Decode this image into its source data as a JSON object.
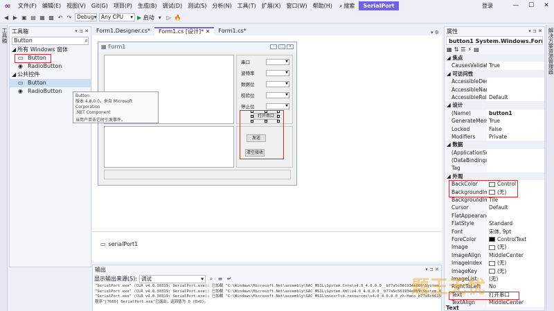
{
  "menu": {
    "items": [
      "文件(F)",
      "编辑(E)",
      "视图(V)",
      "Git(G)",
      "项目(P)",
      "生成(B)",
      "调试(D)",
      "测试(S)",
      "分析(N)",
      "工具(T)",
      "扩展(X)",
      "窗口(W)",
      "帮助(H)"
    ],
    "search_label": "搜索",
    "project_name": "SerialPort",
    "login": "登录"
  },
  "toolbar": {
    "config": "Debug",
    "platform": "Any CPU",
    "start_label": "启动"
  },
  "side": {
    "left_label": "工具箱",
    "right_label": "解决方案资源管理器"
  },
  "toolbox": {
    "title": "工具箱",
    "search_value": "Button",
    "groups": [
      {
        "label": "所有 Windows 窗体",
        "items": [
          "Button",
          "RadioButton"
        ]
      },
      {
        "label": "公共控件",
        "items": [
          "Button",
          "RadioButton"
        ]
      }
    ],
    "tooltip": {
      "name": "Button",
      "version": "版本 4.8.0.0，来自 Microsoft Corporation",
      "component": ".NET Component",
      "desc": "当用户单击它时引发事件。"
    }
  },
  "tabs": [
    "Form1.Designer.cs*",
    "Form1.cs [设计]*",
    "Form1.cs*"
  ],
  "form": {
    "title": "Form1",
    "fields": [
      {
        "label": "串口"
      },
      {
        "label": "波特率"
      },
      {
        "label": "数据位"
      },
      {
        "label": "校验位"
      },
      {
        "label": "停止位"
      }
    ],
    "open_button": "打开串口",
    "send_button": "发送",
    "clear_button": "清空接收"
  },
  "tray": {
    "component": "serialPort1"
  },
  "output": {
    "title": "输出",
    "source_label": "显示输出来源(S):",
    "source_value": "调试",
    "lines": [
      "\"SerialPort.exe\" (CLR v4.0.30319: SerialPort.exe): 已加载 \"C:\\Windows\\Microsoft.Net\\assembly\\GAC_MSIL\\System.Core\\v4.0_4.0.0.0__b77a5c561934e089\\System.Core.dll\"",
      "\"SerialPort.exe\" (CLR v4.0.30319: SerialPort.exe): 已加载 \"C:\\Windows\\Microsoft.Net\\assembly\\GAC_MSIL\\System.Xml\\v4.0_4.0.0.0__b77a5c561934e089\\System.Xml.dll\"",
      "\"SerialPort.exe\" (CLR v4.0.30319: SerialPort.exe): 已加载 \"C:\\Windows\\Microsoft.Net\\assembly\\GAC_MSIL\\mscorlib.resources\\v4.0_4.0.0.0_zh-Hans_b77a5c561934e089\\mscorlib.resources.dll\"",
      "程序\"[7660] SerialPort.exe\"已退出，返回值为 0 (0x0)。"
    ]
  },
  "properties": {
    "title": "属性",
    "object": "button1 System.Windows.Forms.Bu",
    "rows": [
      {
        "cat": "焦点"
      },
      {
        "name": "CausesValidatio",
        "value": "True"
      },
      {
        "cat": "可访问性"
      },
      {
        "name": "AccessibleDescr",
        "value": ""
      },
      {
        "name": "AccessibleName",
        "value": ""
      },
      {
        "name": "AccessibleRole",
        "value": "Default"
      },
      {
        "cat": "设计"
      },
      {
        "name": "(Name)",
        "value": "button1",
        "bold": true
      },
      {
        "name": "GenerateMembe",
        "value": "True"
      },
      {
        "name": "Locked",
        "value": "False"
      },
      {
        "name": "Modifiers",
        "value": "Private"
      },
      {
        "cat": "数据"
      },
      {
        "name": "(ApplicationSet",
        "value": ""
      },
      {
        "name": "(DataBindings)",
        "value": ""
      },
      {
        "name": "Tag",
        "value": ""
      },
      {
        "cat": "外观"
      },
      {
        "name": "BackColor",
        "value": "Control",
        "swatch": "#f0f0f0"
      },
      {
        "name": "BackgroundImag",
        "value": "(无)",
        "swatch": "#ffffff"
      },
      {
        "name": "BackgroundIma",
        "value": "Tile"
      },
      {
        "name": "Cursor",
        "value": "Default"
      },
      {
        "name": "FlatAppearance",
        "value": ""
      },
      {
        "name": "FlatStyle",
        "value": "Standard"
      },
      {
        "name": "Font",
        "value": "宋体, 9pt"
      },
      {
        "name": "ForeColor",
        "value": "ControlText",
        "swatch": "#000000"
      },
      {
        "name": "Image",
        "value": "(无)",
        "swatch": "#ffffff"
      },
      {
        "name": "ImageAlign",
        "value": "MiddleCenter"
      },
      {
        "name": "ImageIndex",
        "value": "(无)",
        "swatch": "#ffffff"
      },
      {
        "name": "ImageKey",
        "value": "(无)",
        "swatch": "#ffffff"
      },
      {
        "name": "ImageList",
        "value": "(无)"
      },
      {
        "name": "RightToLeft",
        "value": "No"
      },
      {
        "name": "Text",
        "value": "打开串口"
      },
      {
        "name": "TextAlign",
        "value": "MiddleCenter"
      }
    ],
    "footer": "Text"
  },
  "watermark": "题王无忧"
}
